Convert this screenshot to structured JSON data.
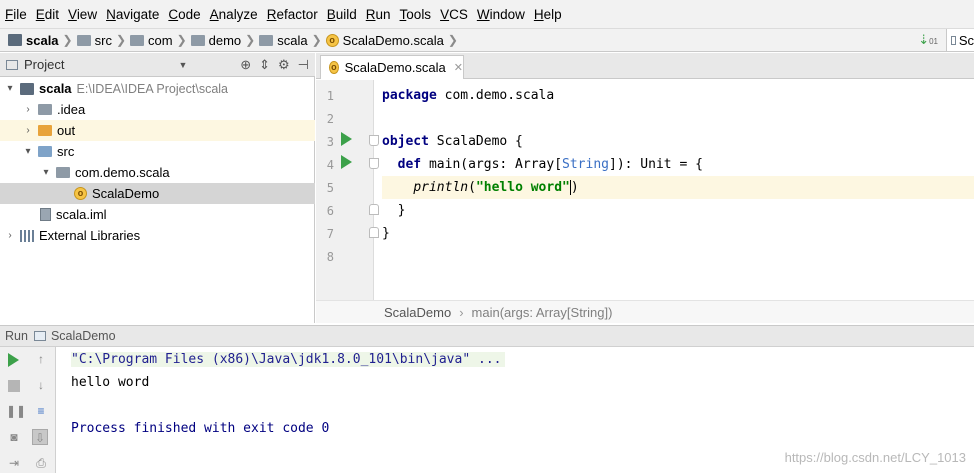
{
  "menu": [
    "File",
    "Edit",
    "View",
    "Navigate",
    "Code",
    "Analyze",
    "Refactor",
    "Build",
    "Run",
    "Tools",
    "VCS",
    "Window",
    "Help"
  ],
  "breadcrumb": [
    {
      "label": "scala",
      "icon": "project-icon"
    },
    {
      "label": "src",
      "icon": "folder-icon"
    },
    {
      "label": "com",
      "icon": "package-icon"
    },
    {
      "label": "demo",
      "icon": "package-icon"
    },
    {
      "label": "scala",
      "icon": "package-icon"
    },
    {
      "label": "ScalaDemo.scala",
      "icon": "scala-object-icon"
    }
  ],
  "run_config_label": "Sc",
  "project_panel": {
    "title": "Project",
    "tree": [
      {
        "label": "scala",
        "path": "E:\\IDEA\\IDEA Project\\scala",
        "depth": 0,
        "expanded": true,
        "icon": "project-icon"
      },
      {
        "label": ".idea",
        "depth": 1,
        "expanded": false,
        "icon": "folder-icon"
      },
      {
        "label": "out",
        "depth": 1,
        "expanded": false,
        "icon": "folder-orange-icon"
      },
      {
        "label": "src",
        "depth": 1,
        "expanded": true,
        "icon": "folder-blue-icon"
      },
      {
        "label": "com.demo.scala",
        "depth": 2,
        "expanded": true,
        "icon": "package-icon"
      },
      {
        "label": "ScalaDemo",
        "depth": 3,
        "icon": "scala-object-icon"
      },
      {
        "label": "scala.iml",
        "depth": 1,
        "icon": "module-file-icon"
      },
      {
        "label": "External Libraries",
        "depth": 0,
        "expanded": false,
        "icon": "library-icon"
      }
    ]
  },
  "editor": {
    "tab_label": "ScalaDemo.scala",
    "line_numbers": [
      "1",
      "2",
      "3",
      "4",
      "5",
      "6",
      "7",
      "8"
    ],
    "lines": {
      "l1_kw": "package",
      "l1_rest": " com.demo.scala",
      "l3_kw": "object",
      "l3_rest": " ScalaDemo {",
      "l4_kw": "def",
      "l4_a": " main(args: Array[",
      "l4_type": "String",
      "l4_b": "]): Unit = {",
      "l5_fn": "println",
      "l5_open": "(",
      "l5_str": "\"hello word\"",
      "l5_close": ")",
      "l6": "  }",
      "l7": "}"
    },
    "status_crumb": "ScalaDemo",
    "status_sub": "main(args: Array[String])"
  },
  "run_panel": {
    "tab_label": "Run",
    "config_label": "ScalaDemo",
    "console": {
      "command": "\"C:\\Program Files (x86)\\Java\\jdk1.8.0_101\\bin\\java\" ...",
      "output": "hello word",
      "exit": "Process finished with exit code 0"
    }
  },
  "watermark": "https://blog.csdn.net/LCY_1013",
  "colors": {
    "accent_run": "#3ca14a",
    "keyword": "#000080",
    "string": "#008000",
    "type": "#3a6fc4",
    "current_line": "#fdf7e1"
  }
}
